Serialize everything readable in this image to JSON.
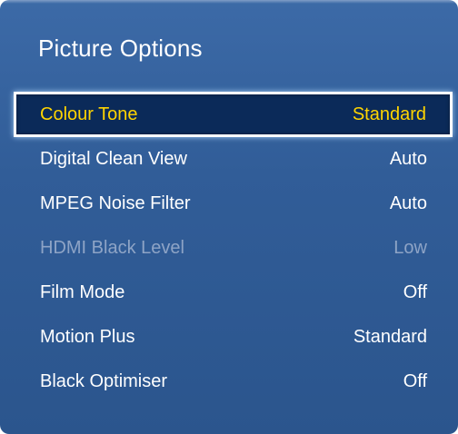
{
  "menu": {
    "title": "Picture Options",
    "options": [
      {
        "label": "Colour Tone",
        "value": "Standard",
        "state": "selected"
      },
      {
        "label": "Digital Clean View",
        "value": "Auto",
        "state": "normal"
      },
      {
        "label": "MPEG Noise Filter",
        "value": "Auto",
        "state": "normal"
      },
      {
        "label": "HDMI Black Level",
        "value": "Low",
        "state": "disabled"
      },
      {
        "label": "Film Mode",
        "value": "Off",
        "state": "normal"
      },
      {
        "label": "Motion Plus",
        "value": "Standard",
        "state": "normal"
      },
      {
        "label": "Black Optimiser",
        "value": "Off",
        "state": "normal"
      }
    ]
  },
  "colors": {
    "panel_background": "#315d98",
    "selected_background": "#0b2a59",
    "selected_text": "#ffd400",
    "normal_text": "#ffffff",
    "disabled_text": "#8ea4c6"
  }
}
